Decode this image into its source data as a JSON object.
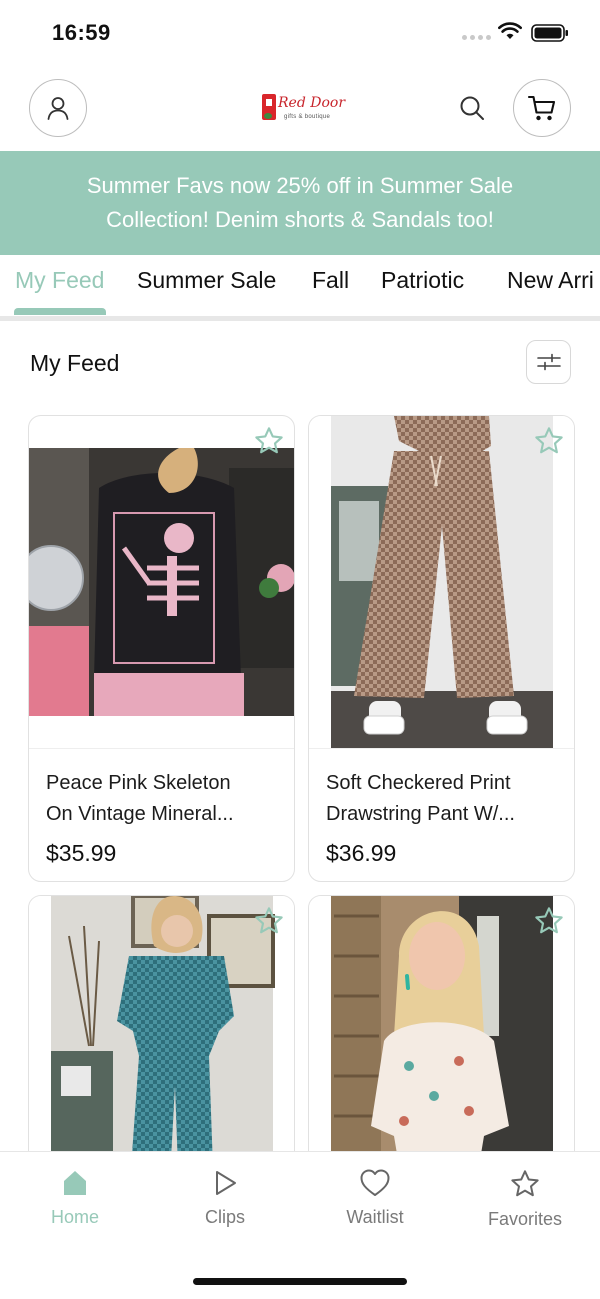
{
  "status_bar": {
    "time": "16:59"
  },
  "header": {
    "logo_name": "Red Door",
    "logo_tagline": "gifts & boutique"
  },
  "banner": {
    "line1": "Summer Favs now 25% off in Summer Sale",
    "line2": "Collection! Denim shorts & Sandals too!"
  },
  "tabs": [
    {
      "label": "My Feed",
      "active": true
    },
    {
      "label": "Summer Sale",
      "active": false
    },
    {
      "label": "Fall",
      "active": false
    },
    {
      "label": "Patriotic",
      "active": false
    },
    {
      "label": "New Arri",
      "active": false
    }
  ],
  "feed": {
    "title": "My Feed"
  },
  "products": [
    {
      "name_line1": "Peace Pink Skeleton",
      "name_line2": "On Vintage Mineral...",
      "price": "$35.99"
    },
    {
      "name_line1": "Soft Checkered Print",
      "name_line2": "Drawstring Pant W/...",
      "price": "$36.99"
    },
    {
      "name_line1": "",
      "name_line2": "",
      "price": ""
    },
    {
      "name_line1": "",
      "name_line2": "",
      "price": ""
    }
  ],
  "bottom_nav": [
    {
      "label": "Home",
      "icon": "home-icon",
      "active": true
    },
    {
      "label": "Clips",
      "icon": "play-icon",
      "active": false
    },
    {
      "label": "Waitlist",
      "icon": "heart-icon",
      "active": false
    },
    {
      "label": "Favorites",
      "icon": "star-icon",
      "active": false
    }
  ],
  "colors": {
    "accent": "#97c9b8",
    "brand_red": "#d9262b",
    "text": "#1c1c1c",
    "muted": "#7a7a7a"
  }
}
